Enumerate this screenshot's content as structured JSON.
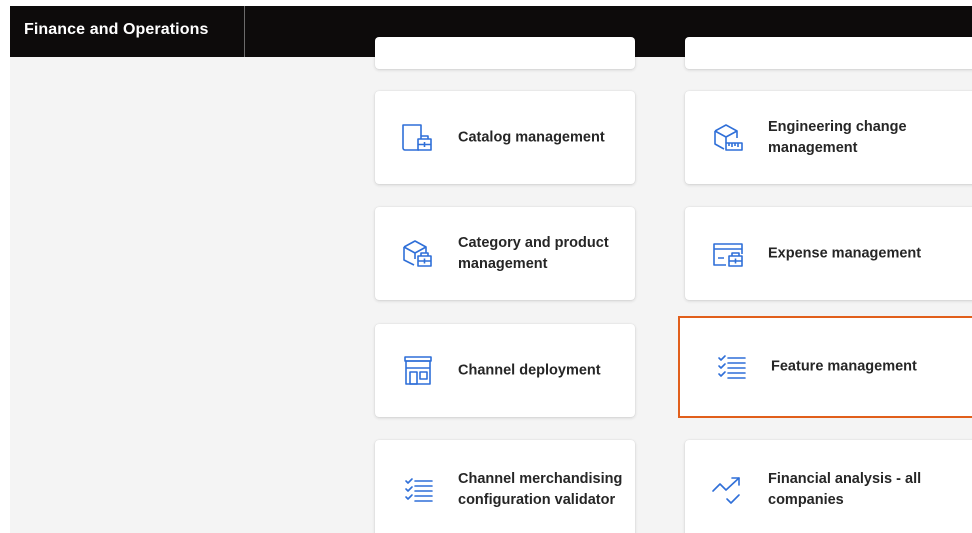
{
  "app": {
    "title": "Finance and Operations"
  },
  "colors": {
    "topbar": "#0d0b0b",
    "workspace": "#f4f4f4",
    "icon_blue": "#2f6fd8",
    "highlight": "#e15f1b"
  },
  "tiles": [
    {
      "label": "",
      "icon": "none"
    },
    {
      "label": "",
      "icon": "none"
    },
    {
      "label": "Catalog management",
      "icon": "catalog-icon"
    },
    {
      "label": "Engineering change management",
      "icon": "engineering-change-icon"
    },
    {
      "label": "Category and product management",
      "icon": "category-product-icon"
    },
    {
      "label": "Expense management",
      "icon": "expense-icon"
    },
    {
      "label": "Channel deployment",
      "icon": "store-icon"
    },
    {
      "label": "Feature management",
      "icon": "checklist-icon",
      "highlighted": true
    },
    {
      "label": "Channel merchandising configuration validator",
      "icon": "checklist-icon"
    },
    {
      "label": "Financial analysis - all companies",
      "icon": "trend-icon"
    }
  ]
}
